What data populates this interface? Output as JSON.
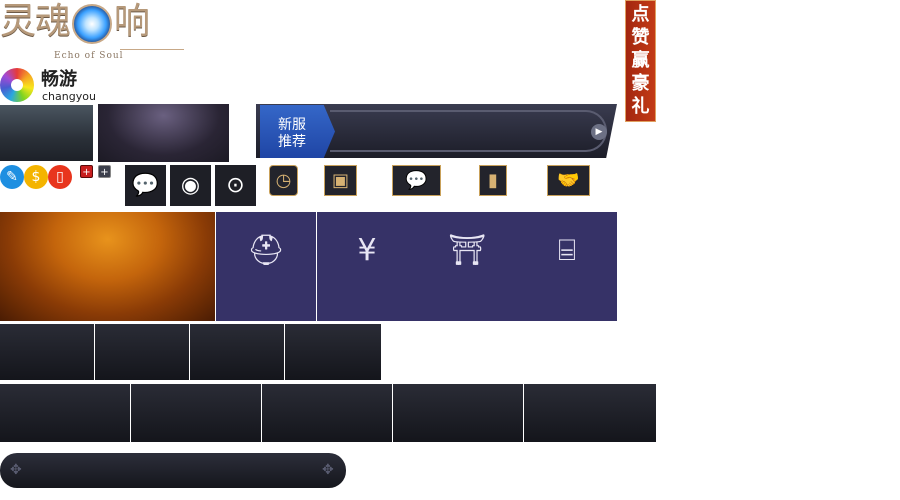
{
  "logo": {
    "title_left": "灵魂",
    "title_right": "响",
    "subtitle": "Echo of Soul"
  },
  "publisher": {
    "name": "畅游",
    "latin": "changyou"
  },
  "banner": {
    "tag_line1": "新服",
    "tag_line2": "推荐",
    "arrow": "▶"
  },
  "like_badge": {
    "chars": [
      "点",
      "赞",
      "赢",
      "豪",
      "礼"
    ]
  },
  "icons": {
    "pencil": "✎",
    "money": "$",
    "phone": "▯",
    "plus": "+",
    "wechat": "💬",
    "weibo": "◉",
    "qr": "⊙",
    "clock": "◷",
    "photo": "▣",
    "chat": "💬",
    "book": "▮",
    "handshake": "🤝",
    "helmet": "⛑",
    "moneybag": "¥",
    "shrine": "⛩",
    "scroll": "⌸",
    "drag": "✥"
  }
}
